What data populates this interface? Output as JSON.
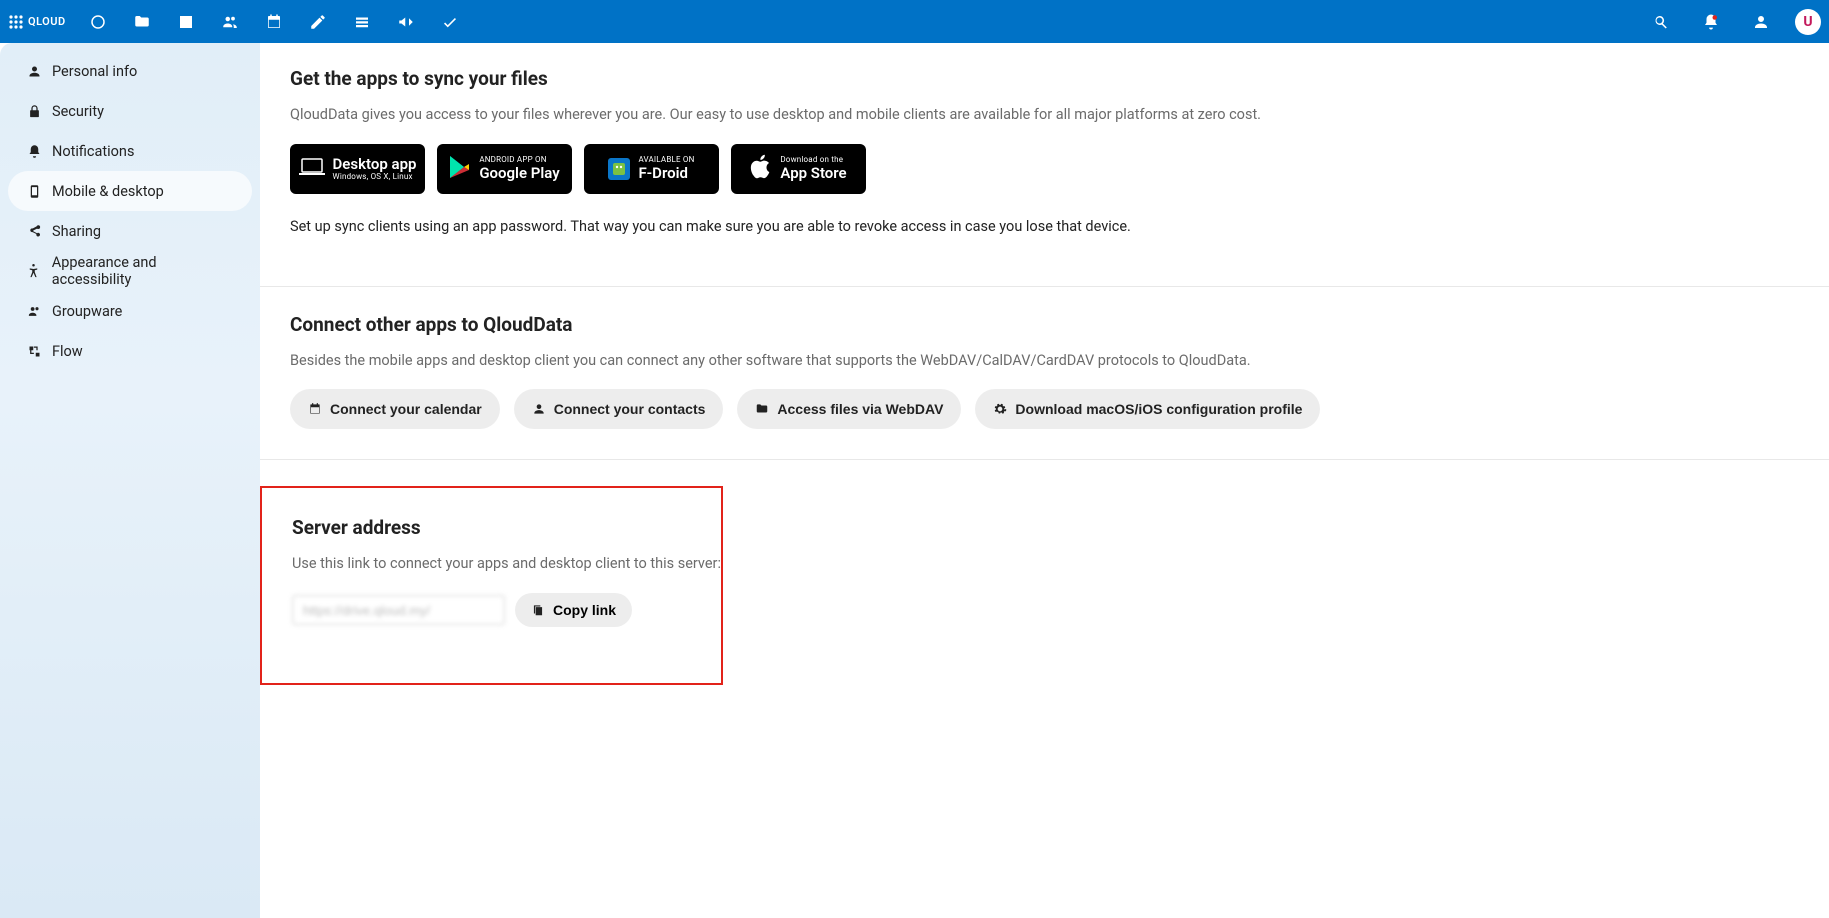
{
  "brand": "QLOUD",
  "topbar": {
    "icons": [
      "circle",
      "folder",
      "image",
      "users",
      "calendar",
      "pencil",
      "stack",
      "announce",
      "check"
    ],
    "right_icons": [
      "search",
      "bell",
      "contacts"
    ]
  },
  "avatar_initial": "U",
  "sidebar": {
    "items": [
      {
        "label": "Personal info",
        "icon": "user"
      },
      {
        "label": "Security",
        "icon": "lock"
      },
      {
        "label": "Notifications",
        "icon": "bell"
      },
      {
        "label": "Mobile & desktop",
        "icon": "phone",
        "active": true
      },
      {
        "label": "Sharing",
        "icon": "share"
      },
      {
        "label": "Appearance and accessibility",
        "icon": "accessibility"
      },
      {
        "label": "Groupware",
        "icon": "group"
      },
      {
        "label": "Flow",
        "icon": "flow"
      }
    ]
  },
  "apps_section": {
    "title": "Get the apps to sync your files",
    "desc": "QloudData gives you access to your files wherever you are. Our easy to use desktop and mobile clients are available for all major platforms at zero cost.",
    "badges": {
      "desktop": {
        "line1": "Desktop app",
        "line2": "Windows, OS X, Linux"
      },
      "google": {
        "line1": "ANDROID APP ON",
        "line2": "Google Play"
      },
      "fdroid": {
        "line1": "AVAILABLE ON",
        "line2": "F-Droid"
      },
      "appstore": {
        "line1": "Download on the",
        "line2": "App Store"
      }
    },
    "note": "Set up sync clients using an app password. That way you can make sure you are able to revoke access in case you lose that device."
  },
  "connect_section": {
    "title": "Connect other apps to QloudData",
    "desc": "Besides the mobile apps and desktop client you can connect any other software that supports the WebDAV/CalDAV/CardDAV protocols to QloudData.",
    "buttons": {
      "calendar": "Connect your calendar",
      "contacts": "Connect your contacts",
      "webdav": "Access files via WebDAV",
      "macos": "Download macOS/iOS configuration profile"
    }
  },
  "server_section": {
    "title": "Server address",
    "desc": "Use this link to connect your apps and desktop client to this server:",
    "url_value": "https://drive.qloud.my/",
    "copy_label": "Copy link"
  }
}
